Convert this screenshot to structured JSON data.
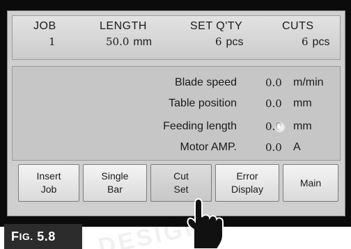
{
  "header": {
    "job": {
      "label": "JOB",
      "value": "1"
    },
    "length": {
      "label": "LENGTH",
      "value": "50.0",
      "unit": "mm"
    },
    "set_qty": {
      "label": "SET Q'TY",
      "value": "6",
      "unit": "pcs"
    },
    "cuts": {
      "label": "CUTS",
      "value": "6",
      "unit": "pcs"
    }
  },
  "status": [
    {
      "label": "Blade speed",
      "value": "0.0",
      "unit": "m/min"
    },
    {
      "label": "Table position",
      "value": "0.0",
      "unit": "mm"
    },
    {
      "label": "Feeding length",
      "value": "0.0",
      "unit": "mm"
    },
    {
      "label": "Motor AMP.",
      "value": "0.0",
      "unit": "A"
    }
  ],
  "buttons": [
    {
      "line1": "Insert",
      "line2": "Job"
    },
    {
      "line1": "Single",
      "line2": "Bar"
    },
    {
      "line1": "Cut",
      "line2": "Set"
    },
    {
      "line1": "Error",
      "line2": "Display"
    },
    {
      "line1": "Main",
      "line2": ""
    }
  ],
  "pressed_button": "Cut Set",
  "figure": {
    "prefix": "F",
    "small": "IG.",
    "number": "5.8"
  },
  "watermark": "DESIGNS",
  "icons": {
    "pointer": "hand-pointer-icon"
  },
  "colors": {
    "screen": "#cfcfcf",
    "bezel": "#0b0b0b",
    "caption_bg": "#2c2c2c"
  }
}
